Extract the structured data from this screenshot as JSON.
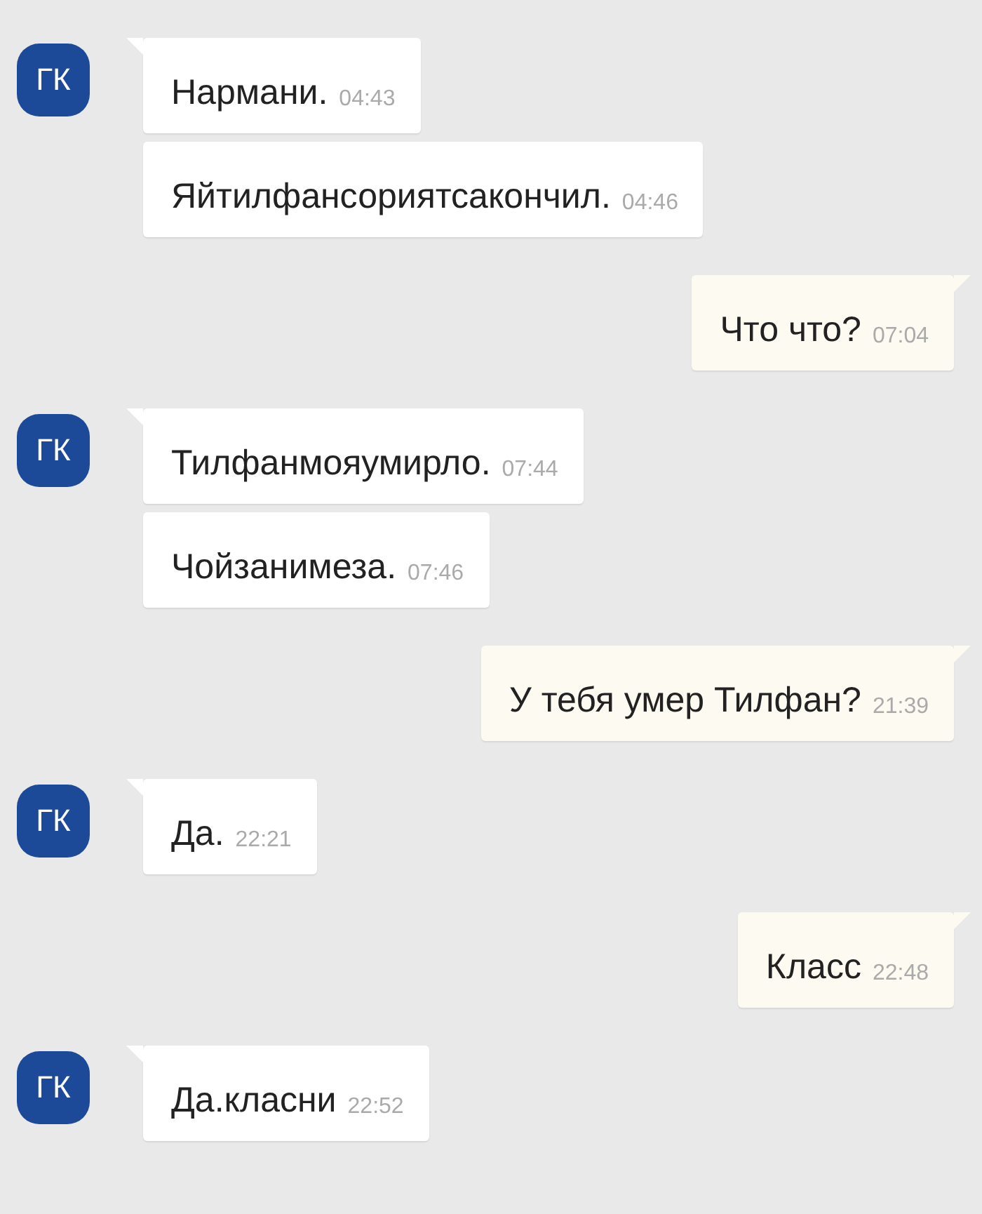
{
  "groups": [
    {
      "kind": "in",
      "avatar": "ГК",
      "messages": [
        {
          "text": "Нармани.",
          "time": "04:43"
        },
        {
          "text": "Яйтилфансориятсакончил.",
          "time": "04:46"
        }
      ]
    },
    {
      "kind": "out",
      "messages": [
        {
          "text": "Что что?",
          "time": "07:04"
        }
      ]
    },
    {
      "kind": "in",
      "avatar": "ГК",
      "messages": [
        {
          "text": "Тилфанмояумирло.",
          "time": "07:44"
        },
        {
          "text": "Чойзанимеза.",
          "time": "07:46"
        }
      ]
    },
    {
      "kind": "out",
      "messages": [
        {
          "text": "У тебя умер Тилфан?",
          "time": "21:39"
        }
      ]
    },
    {
      "kind": "in",
      "avatar": "ГК",
      "messages": [
        {
          "text": "Да.",
          "time": "22:21"
        }
      ]
    },
    {
      "kind": "out",
      "messages": [
        {
          "text": "Класс",
          "time": "22:48"
        }
      ]
    },
    {
      "kind": "in",
      "avatar": "ГК",
      "messages": [
        {
          "text": "Да.класни",
          "time": "22:52"
        }
      ]
    }
  ]
}
